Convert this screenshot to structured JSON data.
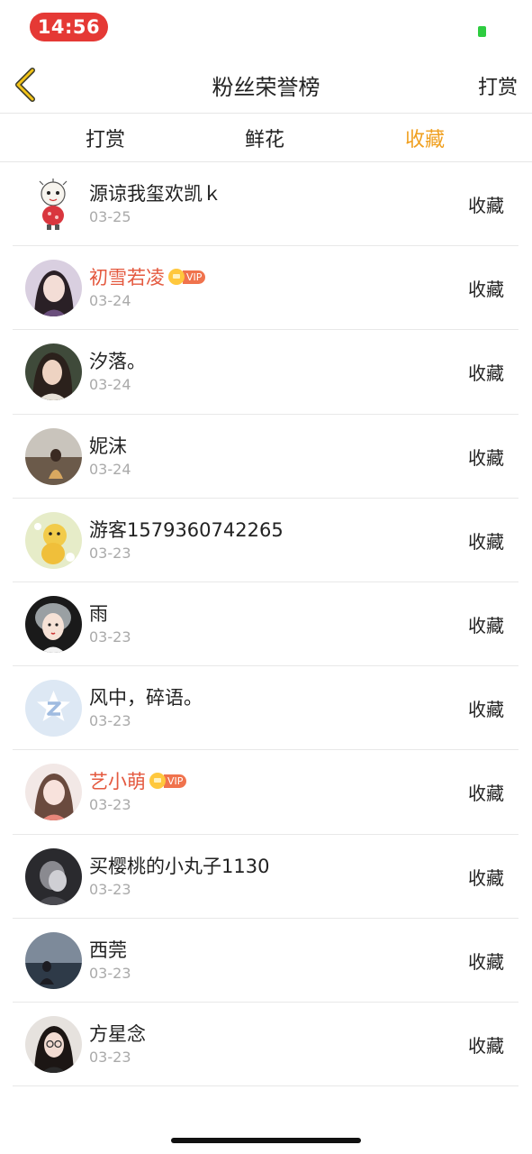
{
  "status_bar": {
    "time": "14:56",
    "time_pill_color": "#e53935",
    "battery_color": "#2ecc40"
  },
  "nav": {
    "back_icon": "chevron-left-icon",
    "title": "粉丝荣誉榜",
    "right_label": "打赏"
  },
  "tabs": [
    {
      "label": "打赏",
      "active": false
    },
    {
      "label": "鲜花",
      "active": false
    },
    {
      "label": "收藏",
      "active": true
    }
  ],
  "colors": {
    "active_tab": "#f0a020",
    "vip_name": "#e4593f",
    "date": "#aaaaaa"
  },
  "vip_badge_text": "VIP",
  "fans": [
    {
      "name": "源谅我玺欢凯ｋ",
      "date": "03-25",
      "action": "收藏",
      "vip": false
    },
    {
      "name": "初雪若凌",
      "date": "03-24",
      "action": "收藏",
      "vip": true
    },
    {
      "name": "汐落。",
      "date": "03-24",
      "action": "收藏",
      "vip": false
    },
    {
      "name": "妮沫",
      "date": "03-24",
      "action": "收藏",
      "vip": false
    },
    {
      "name": "游客1579360742265",
      "date": "03-23",
      "action": "收藏",
      "vip": false
    },
    {
      "name": "雨",
      "date": "03-23",
      "action": "收藏",
      "vip": false
    },
    {
      "name": "风中，碎语。",
      "date": "03-23",
      "action": "收藏",
      "vip": false
    },
    {
      "name": "艺小萌",
      "date": "03-23",
      "action": "收藏",
      "vip": true
    },
    {
      "name": "买樱桃的小丸子1130",
      "date": "03-23",
      "action": "收藏",
      "vip": false
    },
    {
      "name": "西莞",
      "date": "03-23",
      "action": "收藏",
      "vip": false
    },
    {
      "name": "方星念",
      "date": "03-23",
      "action": "收藏",
      "vip": false
    }
  ]
}
